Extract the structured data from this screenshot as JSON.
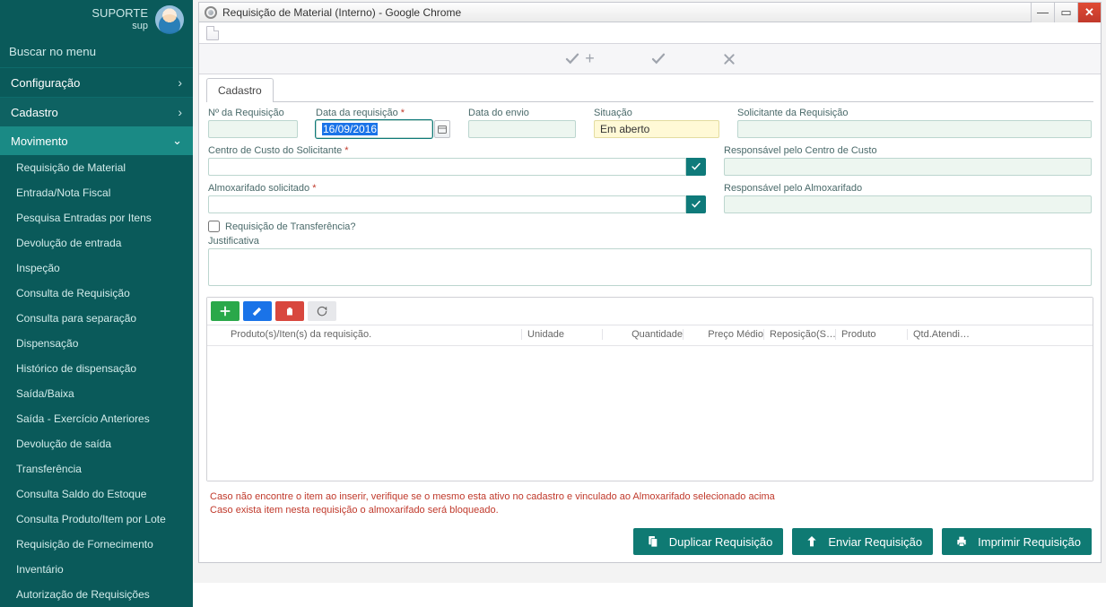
{
  "sidebar": {
    "user_title": "SUPORTE",
    "user_sub": "sup",
    "search_placeholder": "Buscar no menu",
    "groups": [
      {
        "label": "Configuração"
      },
      {
        "label": "Cadastro"
      }
    ],
    "sub_group": "Movimento",
    "items": [
      "Requisição de Material",
      "Entrada/Nota Fiscal",
      "Pesquisa Entradas por Itens",
      "Devolução de entrada",
      "Inspeção",
      "Consulta de Requisição",
      "Consulta para separação",
      "Dispensação",
      "Histórico de dispensação",
      "Saída/Baixa",
      "Saída - Exercício Anteriores",
      "Devolução de saída",
      "Transferência",
      "Consulta Saldo do Estoque",
      "Consulta Produto/Item por Lote",
      "Requisição de Fornecimento",
      "Inventário",
      "Autorização de Requisições"
    ]
  },
  "window": {
    "title": "Requisição de Material (Interno) - Google Chrome"
  },
  "tabs": {
    "cadastro": "Cadastro"
  },
  "form": {
    "num_req_label": "Nº da Requisição",
    "data_req_label": "Data da requisição",
    "data_req_value": "16/09/2016",
    "data_envio_label": "Data do envio",
    "situacao_label": "Situação",
    "situacao_value": "Em aberto",
    "solicitante_label": "Solicitante da Requisição",
    "centro_label": "Centro de Custo do Solicitante",
    "resp_centro_label": "Responsável pelo Centro de Custo",
    "almox_label": "Almoxarifado solicitado",
    "resp_almox_label": "Responsável pelo Almoxarifado",
    "transf_label": "Requisição de Transferência?",
    "just_label": "Justificativa"
  },
  "grid": {
    "headers": {
      "produto_item": "Produto(s)/Iten(s) da requisição.",
      "unidade": "Unidade",
      "quantidade": "Quantidade",
      "preco": "Preço Médio",
      "reposicao": "Reposição(S…",
      "produto": "Produto",
      "qtd_at": "Qtd.Atendi…"
    }
  },
  "notes": {
    "l1": "Caso não encontre o item ao inserir, verifique se o mesmo esta ativo no cadastro e vinculado ao Almoxarifado selecionado acima",
    "l2": "Caso exista item nesta requisição o almoxarifado será bloqueado."
  },
  "actions": {
    "dup": "Duplicar Requisição",
    "send": "Enviar Requisição",
    "print": "Imprimir Requisição"
  }
}
